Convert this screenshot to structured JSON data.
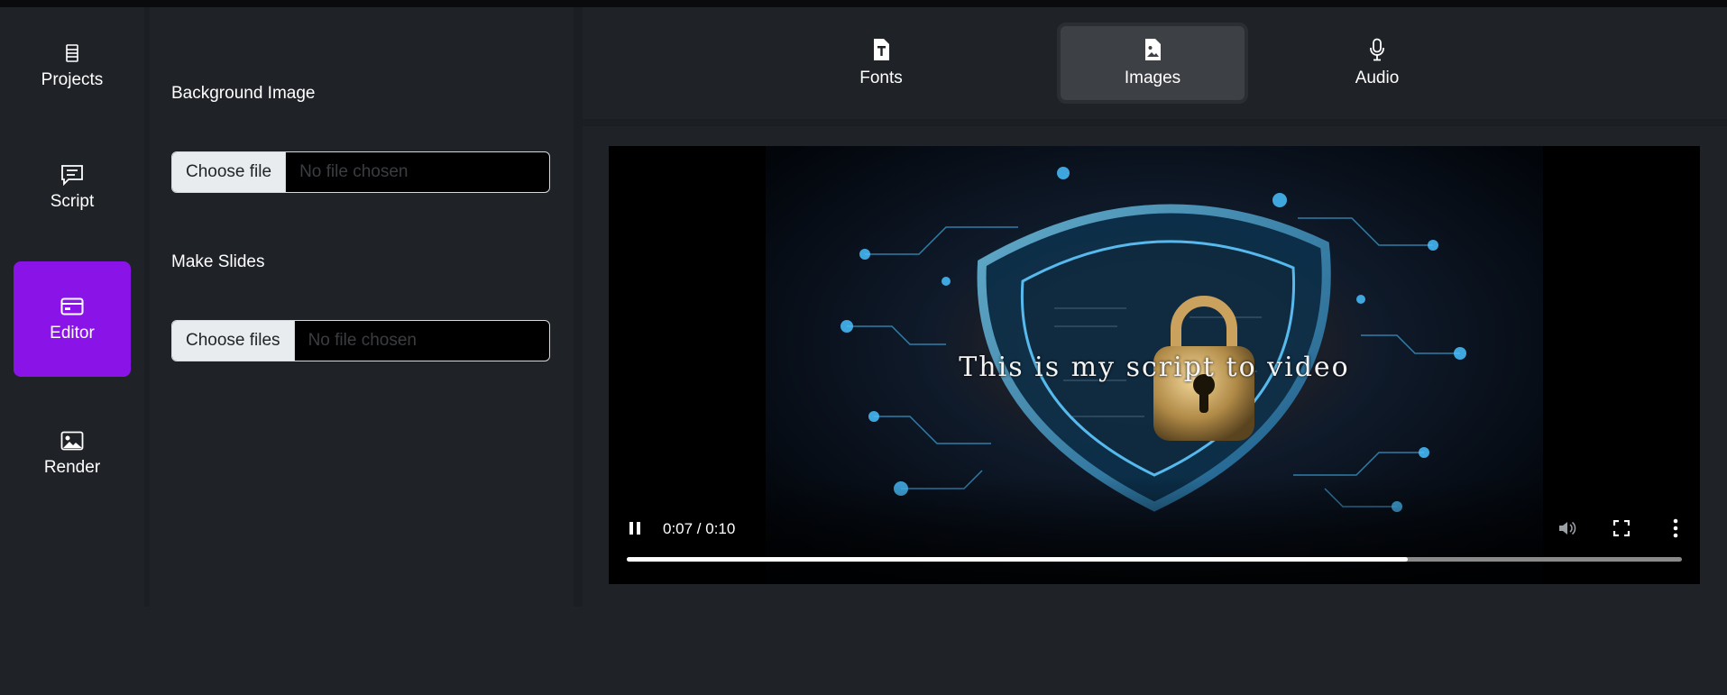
{
  "nav": {
    "items": [
      {
        "label": "Projects",
        "icon": "list-icon"
      },
      {
        "label": "Script",
        "icon": "chat-text-icon"
      },
      {
        "label": "Editor",
        "icon": "card-icon",
        "active": true
      },
      {
        "label": "Render",
        "icon": "image-icon"
      }
    ],
    "accent_color": "#8a14e8"
  },
  "panel": {
    "background_image": {
      "label": "Background Image",
      "button_label": "Choose file",
      "status": "No file chosen"
    },
    "make_slides": {
      "label": "Make Slides",
      "button_label": "Choose files",
      "status": "No file chosen"
    }
  },
  "tabs": [
    {
      "label": "Fonts",
      "icon": "font-file-icon"
    },
    {
      "label": "Images",
      "icon": "image-file-icon",
      "active": true
    },
    {
      "label": "Audio",
      "icon": "microphone-icon"
    }
  ],
  "video": {
    "caption": "This is my script to video",
    "time_display": "0:07 / 0:10",
    "progress": 0.74,
    "state": "playing"
  }
}
